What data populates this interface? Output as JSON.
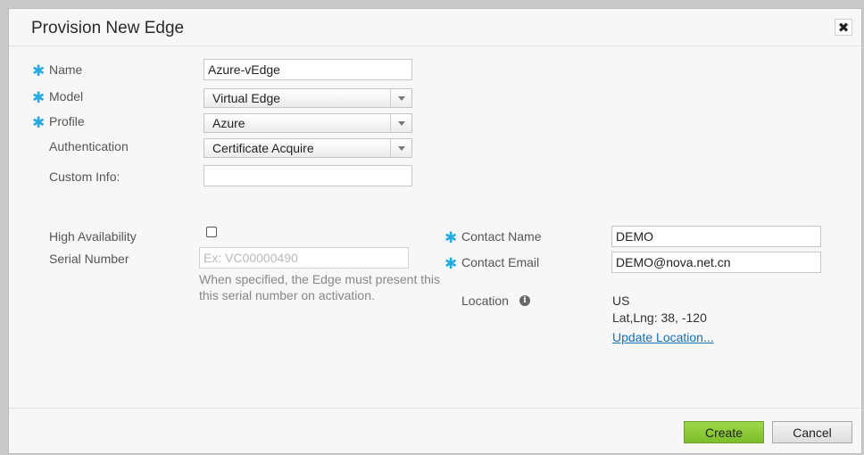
{
  "dialog": {
    "title": "Provision New Edge",
    "close_label": "✖"
  },
  "form": {
    "name": {
      "label": "Name",
      "value": "Azure-vEdge",
      "required": true
    },
    "model": {
      "label": "Model",
      "value": "Virtual Edge",
      "required": true
    },
    "profile": {
      "label": "Profile",
      "value": "Azure",
      "required": true
    },
    "authentication": {
      "label": "Authentication",
      "value": "Certificate Acquire"
    },
    "custom_info": {
      "label": "Custom Info:",
      "value": ""
    },
    "high_availability": {
      "label": "High Availability",
      "checked": false
    },
    "serial_number": {
      "label": "Serial Number",
      "placeholder": "Ex: VC00000490",
      "hint_line1": "When specified, the Edge must present this",
      "hint_line2": "this serial number on activation."
    },
    "contact_name": {
      "label": "Contact Name",
      "value": "DEMO",
      "required": true
    },
    "contact_email": {
      "label": "Contact Email",
      "value": "DEMO@nova.net.cn",
      "required": true
    },
    "location": {
      "label": "Location",
      "country": "US",
      "latlng": "Lat,Lng: 38, -120",
      "update_link": "Update Location..."
    }
  },
  "required_marker": "✱",
  "info_icon_glyph": "i",
  "footer": {
    "create_label": "Create",
    "cancel_label": "Cancel"
  },
  "colors": {
    "required": "#27a9e1",
    "create_button": "#8cc63f",
    "link": "#1a6fb5"
  }
}
